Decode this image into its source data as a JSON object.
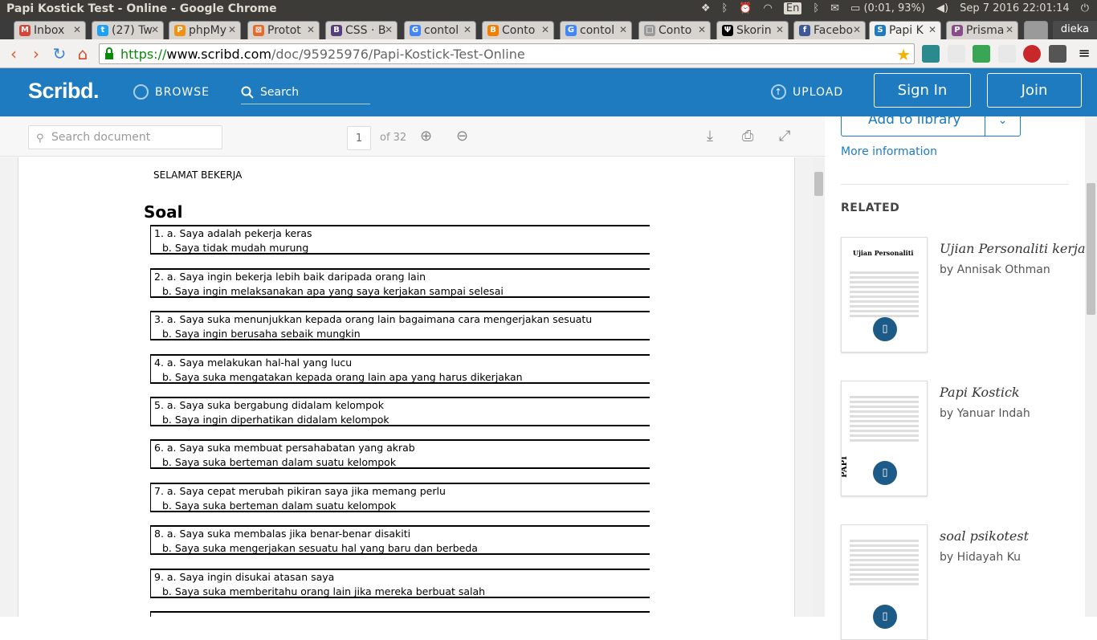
{
  "os": {
    "window_title": "Papi Kostick Test - Online - Google Chrome",
    "keyboard": "En",
    "battery": "(0:01, 93%)",
    "clock": "Sep  7 2016 22:01:14"
  },
  "tabs": [
    {
      "label": "Inbox",
      "fav_color": "#d44638",
      "fav": "M"
    },
    {
      "label": "(27) Tw",
      "fav_color": "#1da1f2",
      "fav": "t"
    },
    {
      "label": "phpMy",
      "fav_color": "#f29111",
      "fav": "P"
    },
    {
      "label": "Protot",
      "fav_color": "#e66a2c",
      "fav": "⊠"
    },
    {
      "label": "CSS · B",
      "fav_color": "#563d7c",
      "fav": "B"
    },
    {
      "label": "contol",
      "fav_color": "#4285f4",
      "fav": "G"
    },
    {
      "label": "Conto",
      "fav_color": "#f57d00",
      "fav": "B"
    },
    {
      "label": "contol",
      "fav_color": "#4285f4",
      "fav": "G"
    },
    {
      "label": "Conto",
      "fav_color": "#999999",
      "fav": "□"
    },
    {
      "label": "Skorin",
      "fav_color": "#000000",
      "fav": "Ψ"
    },
    {
      "label": "Facebo",
      "fav_color": "#3b5998",
      "fav": "f"
    },
    {
      "label": "Papi K",
      "fav_color": "#1e7bc0",
      "fav": "S"
    },
    {
      "label": "Prisma",
      "fav_color": "#8a4b8c",
      "fav": "P"
    }
  ],
  "user": "dieka",
  "address": {
    "scheme": "https://",
    "host": "www.scribd.com",
    "path": "/doc/95925976/Papi-Kostick-Test-Online"
  },
  "scribd": {
    "logo": "Scribd.",
    "browse": "BROWSE",
    "search_placeholder": "Search",
    "upload": "UPLOAD",
    "sign_in": "Sign In",
    "join": "Join"
  },
  "toolbar": {
    "search_placeholder": "Search document",
    "page": "1",
    "of_pages": "of 32"
  },
  "document": {
    "header": "SELAMAT BEKERJA",
    "section_title": "Soal",
    "questions": [
      {
        "a": "1. a. Saya adalah pekerja keras",
        "b": "b. Saya tidak mudah murung"
      },
      {
        "a": "2. a. Saya ingin bekerja lebih baik daripada orang lain",
        "b": "b. Saya ingin melaksanakan apa yang saya kerjakan sampai selesai"
      },
      {
        "a": "3. a. Saya suka menunjukkan kepada orang lain bagaimana cara mengerjakan sesuatu",
        "b": "b. Saya ingin berusaha sebaik mungkin"
      },
      {
        "a": "4. a. Saya melakukan hal-hal yang lucu",
        "b": "b. Saya suka mengatakan kepada orang lain apa yang harus dikerjakan"
      },
      {
        "a": "5. a. Saya suka bergabung didalam kelompok",
        "b": "b. Saya ingin diperhatikan didalam kelompok"
      },
      {
        "a": "6. a. Saya suka membuat persahabatan yang akrab",
        "b": "b. Saya suka berteman dalam suatu kelompok"
      },
      {
        "a": "7. a. Saya cepat merubah pikiran saya jika memang perlu",
        "b": "b. Saya suka berteman dalam suatu kelompok"
      },
      {
        "a": "8. a. Saya suka membalas jika benar-benar disakiti",
        "b": "b. Saya suka mengerjakan sesuatu hal yang baru dan berbeda"
      },
      {
        "a": "9. a. Saya ingin disukai atasan saya",
        "b": "b. Saya suka memberitahu orang lain jika mereka berbuat salah"
      }
    ]
  },
  "sidebar": {
    "add_to_library": "Add to library",
    "more_information": "More information",
    "related_heading": "RELATED",
    "related": [
      {
        "title": "Ujian Personaliti kerjaya",
        "author": "by Annisak Othman",
        "thumb_heading": "Ujian Personaliti"
      },
      {
        "title": "Papi Kostick",
        "author": "by Yanuar Indah",
        "thumb_heading": "PAPI"
      },
      {
        "title": "soal psikotest",
        "author": "by Hidayah Ku",
        "thumb_heading": ""
      }
    ]
  },
  "colors": {
    "scribd_blue": "#1e7bc0",
    "os_bar": "#3c3b37"
  }
}
